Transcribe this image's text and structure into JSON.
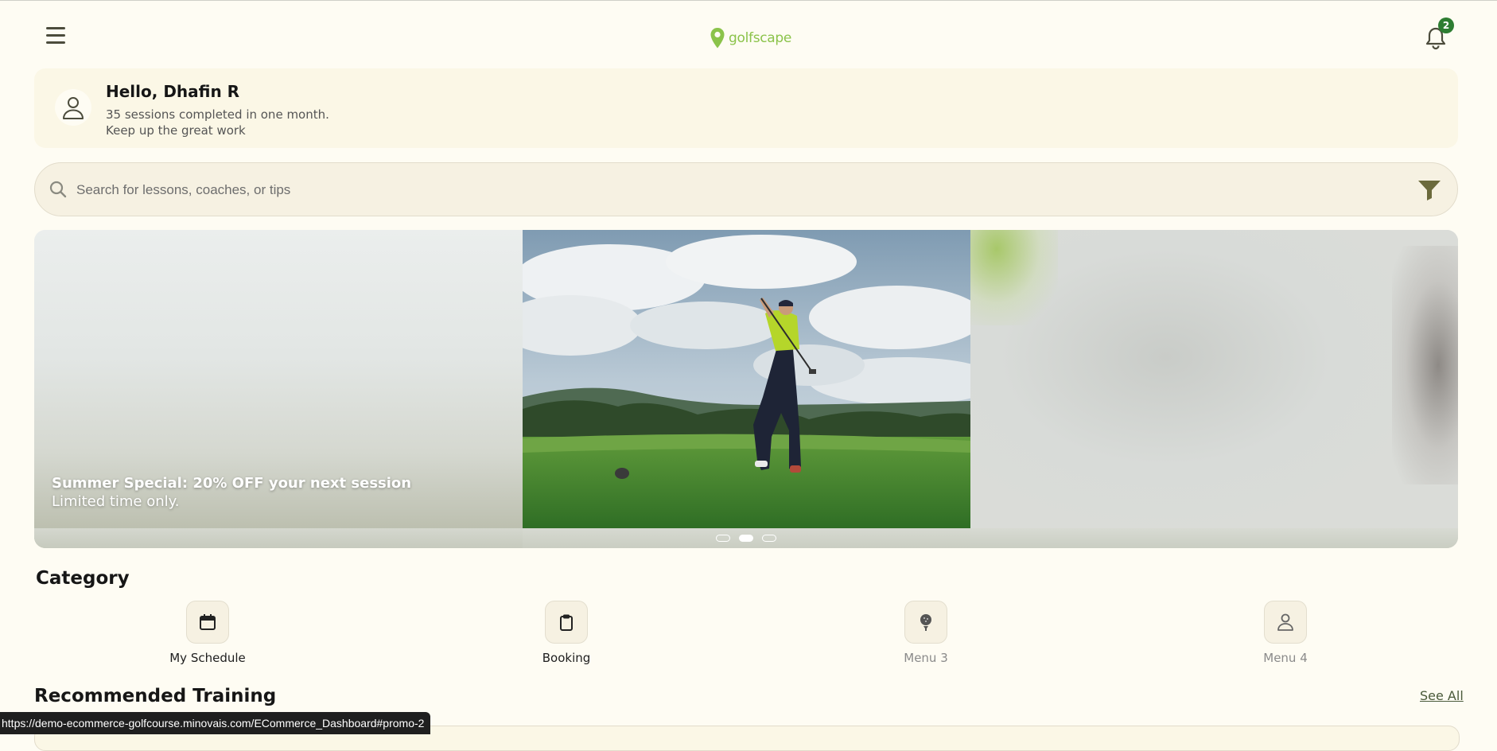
{
  "header": {
    "brand": "golfscape",
    "notification_count": "2"
  },
  "greeting": {
    "title": "Hello, Dhafin R",
    "line1": "35 sessions completed in one month.",
    "line2": "Keep up the great work"
  },
  "search": {
    "placeholder": "Search for lessons, coaches, or tips"
  },
  "carousel": {
    "caption_title": "Summer Special: 20% OFF your next session",
    "caption_sub": "Limited time only.",
    "slide_count": 3,
    "active_slide": 2
  },
  "category": {
    "title": "Category",
    "items": [
      {
        "label": "My Schedule",
        "icon": "calendar-icon"
      },
      {
        "label": "Booking",
        "icon": "clipboard-icon"
      },
      {
        "label": "Menu 3",
        "icon": "golf-ball-icon"
      },
      {
        "label": "Menu 4",
        "icon": "person-icon"
      }
    ]
  },
  "recommended": {
    "title": "Recommended Training",
    "see_all": "See All"
  },
  "status_url": "https://demo-ecommerce-golfcourse.minovais.com/ECommerce_Dashboard#promo-2",
  "colors": {
    "background": "#fefcf3",
    "brand_green": "#8bc34a",
    "badge_green": "#2e7d32"
  }
}
